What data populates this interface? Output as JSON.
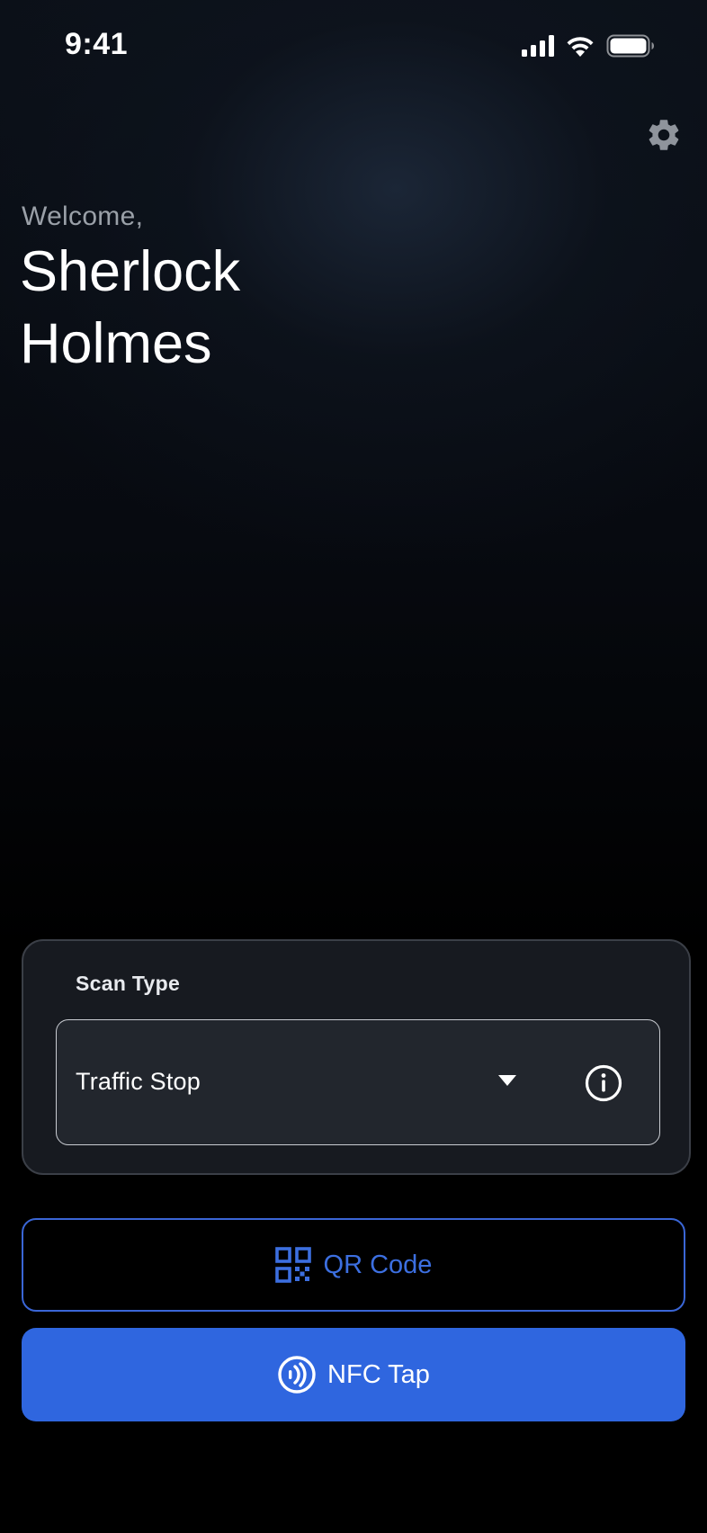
{
  "status_bar": {
    "time": "9:41",
    "icons": [
      "cellular-signal-icon",
      "wifi-icon",
      "battery-icon"
    ]
  },
  "header": {
    "settings_icon": "gear-icon"
  },
  "welcome": {
    "greeting": "Welcome,",
    "name": "Sherlock Holmes"
  },
  "scan_card": {
    "label": "Scan Type",
    "selected_value": "Traffic Stop",
    "dropdown_icon": "chevron-down-icon",
    "info_icon": "info-icon"
  },
  "actions": {
    "qr_label": "QR Code",
    "qr_icon": "qr-code-icon",
    "nfc_label": "NFC Tap",
    "nfc_icon": "nfc-icon"
  },
  "colors": {
    "accent": "#2f66df",
    "outline_accent": "#3a66d6",
    "card_background": "#171a20",
    "background": "#000000"
  }
}
